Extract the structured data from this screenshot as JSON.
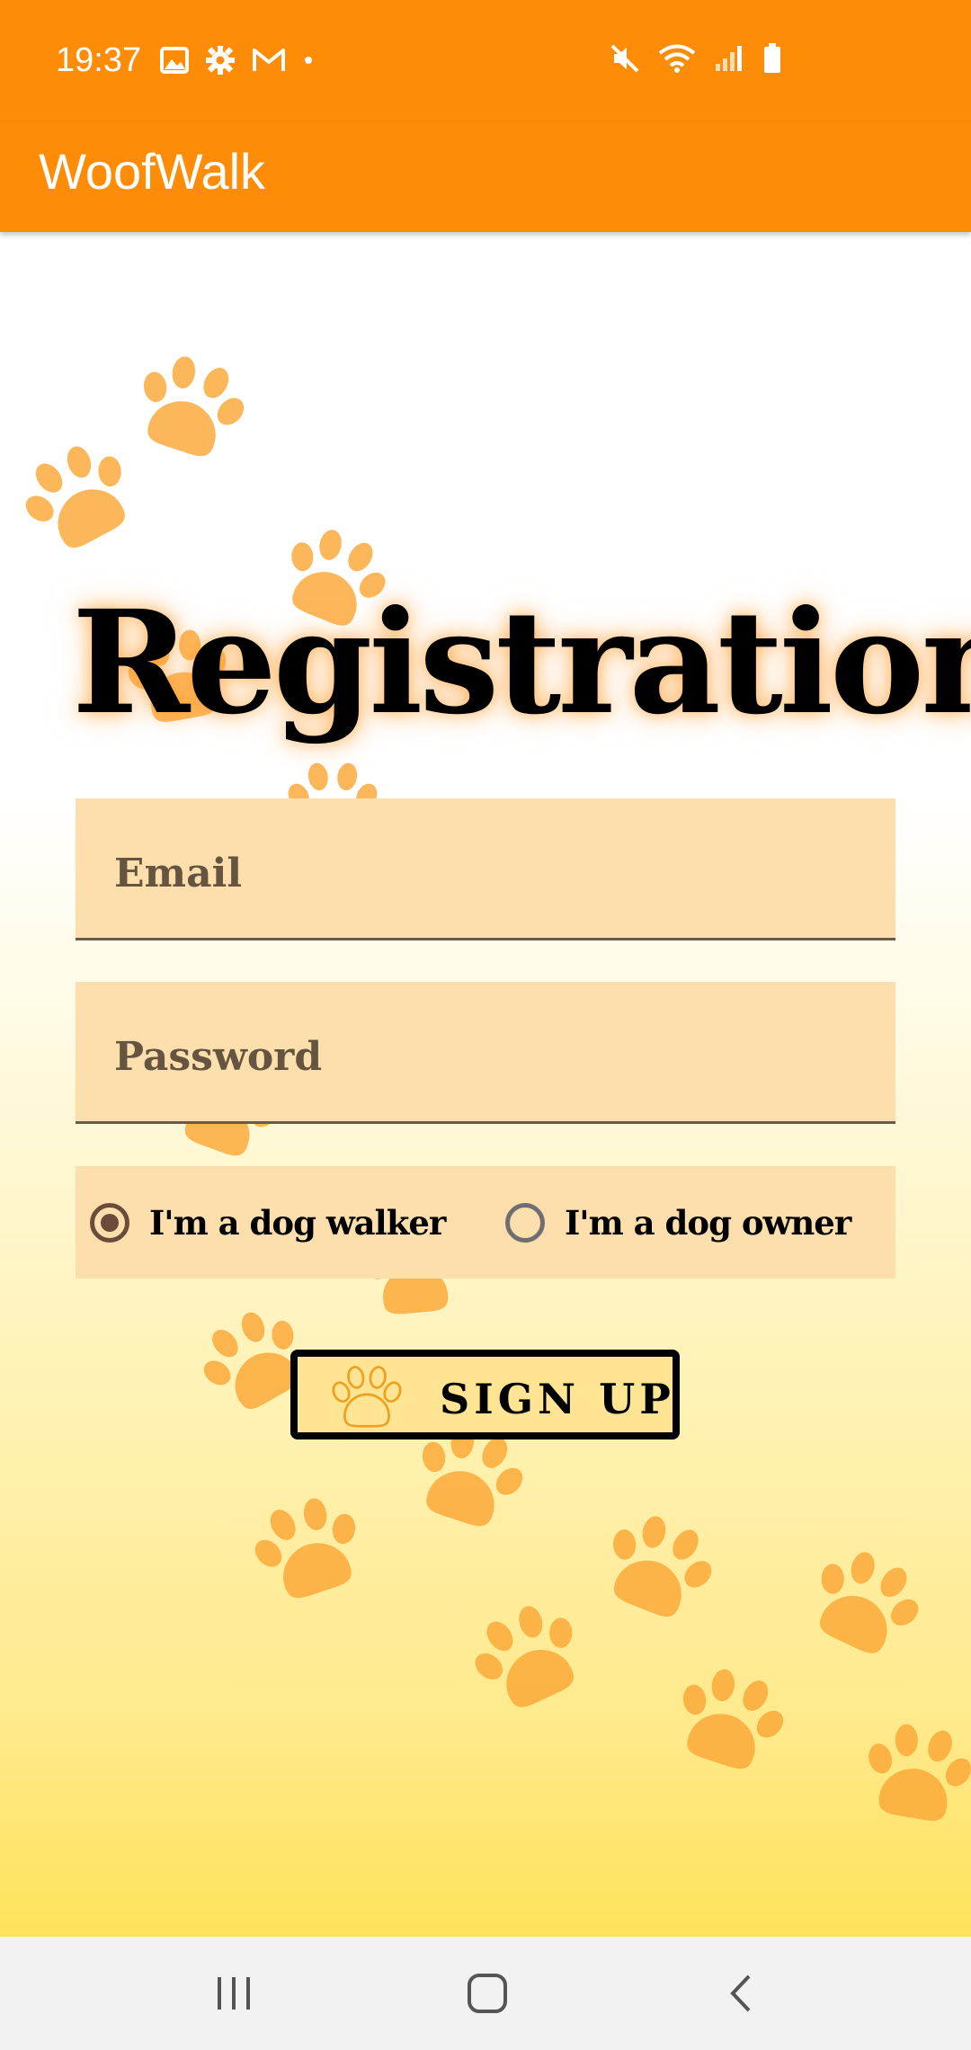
{
  "status_bar": {
    "time": "19:37",
    "left_icons": [
      "image-icon",
      "gear-icon",
      "gmail-icon",
      "dot-icon"
    ],
    "right_icons": [
      "mute-icon",
      "wifi-icon",
      "signal-icon",
      "battery-icon"
    ]
  },
  "app_bar": {
    "title": "WoofWalk"
  },
  "page": {
    "title": "Registration"
  },
  "form": {
    "email_placeholder": "Email",
    "password_placeholder": "Password",
    "role_options": [
      {
        "label": "I'm a dog walker",
        "selected": true
      },
      {
        "label": "I'm a dog owner",
        "selected": false
      }
    ],
    "signup_label": "SIGN UP"
  },
  "colors": {
    "primary": "#FF8C07",
    "field_bg": "#FDDEAD",
    "button_bg": "#FFE593",
    "paw": "#FCA836"
  },
  "nav_bar": {
    "buttons": [
      "recents-icon",
      "home-icon",
      "back-icon"
    ]
  }
}
